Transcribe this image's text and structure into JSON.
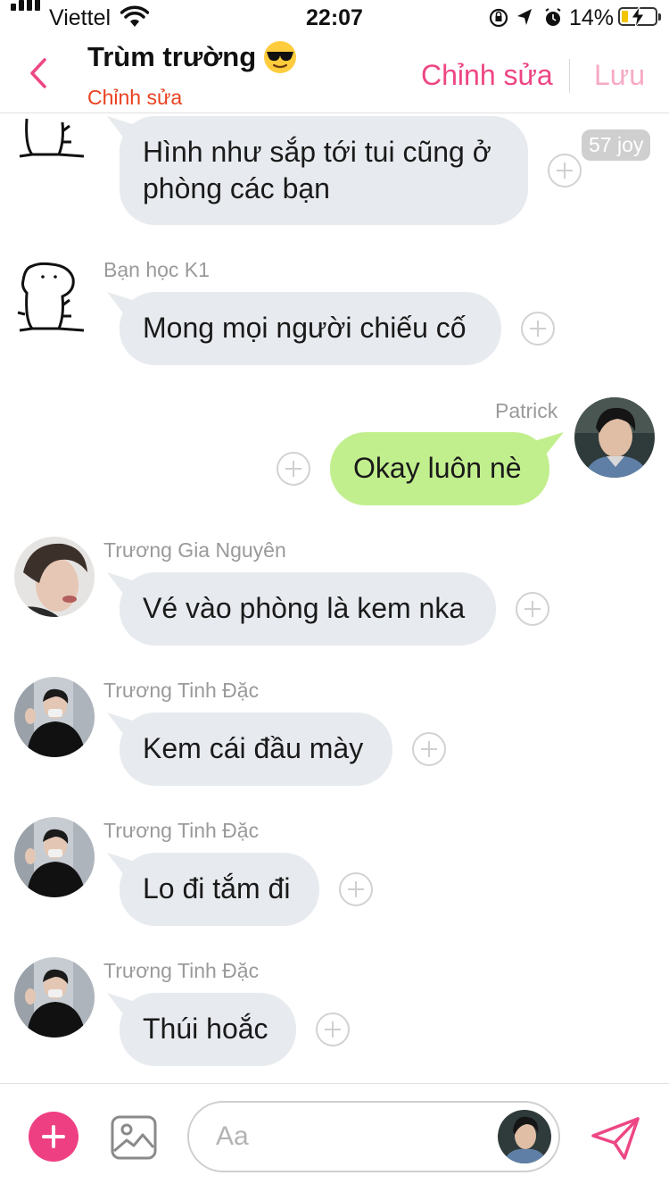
{
  "status_bar": {
    "carrier": "Viettel",
    "time": "22:07",
    "battery": "14%"
  },
  "header": {
    "title": "Trùm trường",
    "subtitle": "Chỉnh sửa",
    "edit_label": "Chỉnh sửa",
    "save_label": "Lưu",
    "accent_color": "#ee4684"
  },
  "messages": [
    {
      "sender": "",
      "text": "Hình như sắp tới tui cũng ở phòng các bạn",
      "badge": "57 joy"
    },
    {
      "sender": "Bạn học K1",
      "text": "Mong mọi người chiếu cố"
    },
    {
      "sender": "Patrick",
      "text": "Okay luôn nè"
    },
    {
      "sender": "Trương Gia Nguyên",
      "text": "Vé vào phòng là kem nka"
    },
    {
      "sender": "Trương Tinh Đặc",
      "text": "Kem cái đầu mày"
    },
    {
      "sender": "Trương Tinh Đặc",
      "text": "Lo đi tắm đi"
    },
    {
      "sender": "Trương Tinh Đặc",
      "text": "Thúi hoắc"
    }
  ],
  "composer": {
    "placeholder": "Aa"
  }
}
